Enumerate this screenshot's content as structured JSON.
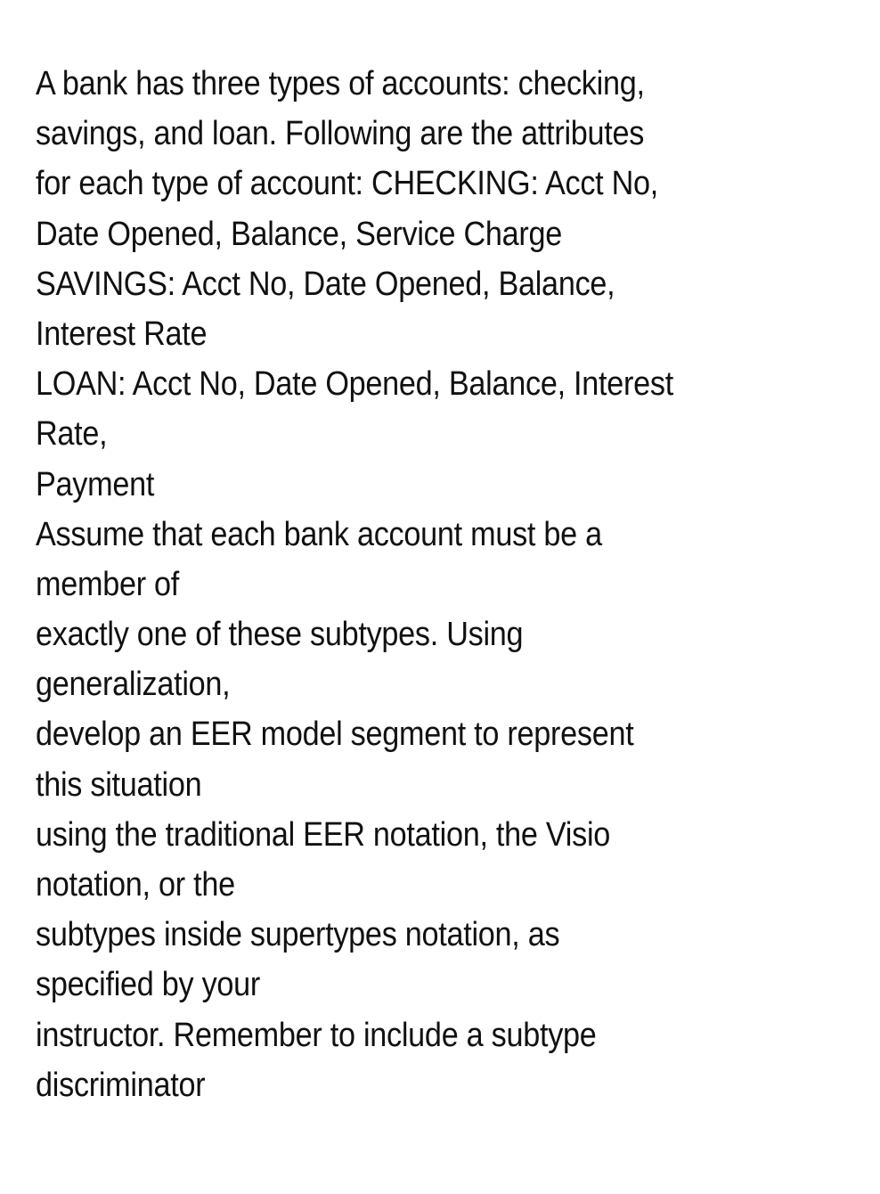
{
  "document": {
    "lines": [
      "A bank has three types of accounts: checking,",
      "savings, and loan. Following are the attributes",
      "for each type of account: CHECKING: Acct No,",
      "Date Opened, Balance, Service Charge",
      "SAVINGS: Acct No, Date Opened, Balance,",
      "Interest Rate",
      "LOAN: Acct No, Date Opened, Balance, Interest",
      "Rate,",
      "Payment",
      "Assume that each bank account must be a",
      "member of",
      "exactly one of these subtypes. Using",
      "generalization,",
      "develop an EER model segment to represent",
      "this situation",
      "using the traditional EER notation, the Visio",
      "notation, or the",
      "subtypes inside supertypes notation, as",
      "specified by your",
      "instructor. Remember to include a subtype",
      "discriminator"
    ]
  }
}
